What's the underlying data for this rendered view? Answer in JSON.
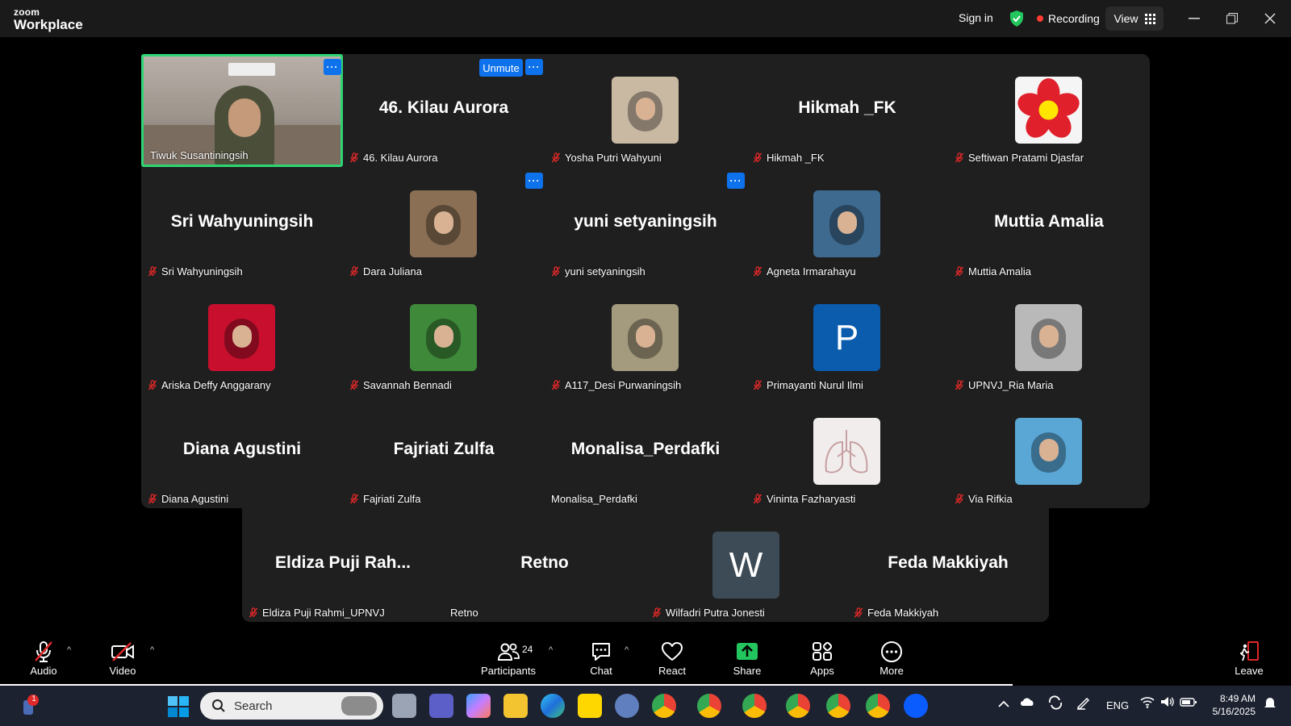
{
  "app": {
    "brand_top": "zoom",
    "brand_bottom": "Workplace"
  },
  "titlebar": {
    "signin": "Sign in",
    "recording": "Recording",
    "view": "View"
  },
  "controls": {
    "unmute": "Unmute",
    "more": "···"
  },
  "participants": [
    {
      "name": "Tiwuk Susantiningsih",
      "big": "",
      "type": "video"
    },
    {
      "name": "46. Kilau Aurora",
      "big": "46. Kilau Aurora",
      "type": "text"
    },
    {
      "name": "Yosha Putri Wahyuni",
      "big": "",
      "type": "photo",
      "color": "#c9b9a3"
    },
    {
      "name": "Hikmah _FK",
      "big": "Hikmah _FK",
      "type": "text"
    },
    {
      "name": "Seftiwan Pratami Djasfar",
      "big": "",
      "type": "flower"
    },
    {
      "name": "Sri Wahyuningsih",
      "big": "Sri Wahyuningsih",
      "type": "text"
    },
    {
      "name": "Dara Juliana",
      "big": "",
      "type": "photo",
      "color": "#8a6f55"
    },
    {
      "name": "yuni setyaningsih",
      "big": "yuni setyaningsih",
      "type": "text"
    },
    {
      "name": "Agneta Irmarahayu",
      "big": "",
      "type": "photo",
      "color": "#3e6a8f"
    },
    {
      "name": "Muttia Amalia",
      "big": "Muttia Amalia",
      "type": "text"
    },
    {
      "name": "Ariska Deffy Anggarany",
      "big": "",
      "type": "photo",
      "color": "#c8102e"
    },
    {
      "name": "Savannah Bennadi",
      "big": "",
      "type": "photo",
      "color": "#3f8a3a"
    },
    {
      "name": "A117_Desi Purwaningsih",
      "big": "",
      "type": "photo",
      "color": "#a49a7d"
    },
    {
      "name": "Primayanti Nurul Ilmi",
      "big": "",
      "type": "letter",
      "letter": "P",
      "color": "#0b5cad"
    },
    {
      "name": "UPNVJ_Ria Maria",
      "big": "",
      "type": "photo",
      "color": "#b9b9b9"
    },
    {
      "name": "Diana Agustini",
      "big": "Diana Agustini",
      "type": "text"
    },
    {
      "name": "Fajriati Zulfa",
      "big": "Fajriati Zulfa",
      "type": "text"
    },
    {
      "name": "Monalisa_Perdafki",
      "big": "Monalisa_Perdafki",
      "type": "text"
    },
    {
      "name": "Vininta Fazharyasti",
      "big": "",
      "type": "lungs"
    },
    {
      "name": "Via Rifkia",
      "big": "",
      "type": "photo",
      "color": "#5aa7d6"
    },
    {
      "name": "Eldiza Puji Rahmi_UPNVJ",
      "big": "Eldiza Puji Rah...",
      "type": "text"
    },
    {
      "name": "Retno",
      "big": "Retno",
      "type": "text"
    },
    {
      "name": "Wilfadri Putra Jonesti",
      "big": "",
      "type": "letter",
      "letter": "W",
      "color": "#3c4b56"
    },
    {
      "name": "Feda Makkiyah",
      "big": "Feda Makkiyah",
      "type": "text"
    }
  ],
  "toolbar": {
    "audio": "Audio",
    "video": "Video",
    "participants": "Participants",
    "participants_count": "24",
    "chat": "Chat",
    "react": "React",
    "share": "Share",
    "apps": "Apps",
    "more": "More",
    "leave": "Leave"
  },
  "taskbar": {
    "search_placeholder": "Search",
    "language": "ENG",
    "time": "8:49 AM",
    "date": "5/16/2025",
    "notification_count": "1"
  }
}
